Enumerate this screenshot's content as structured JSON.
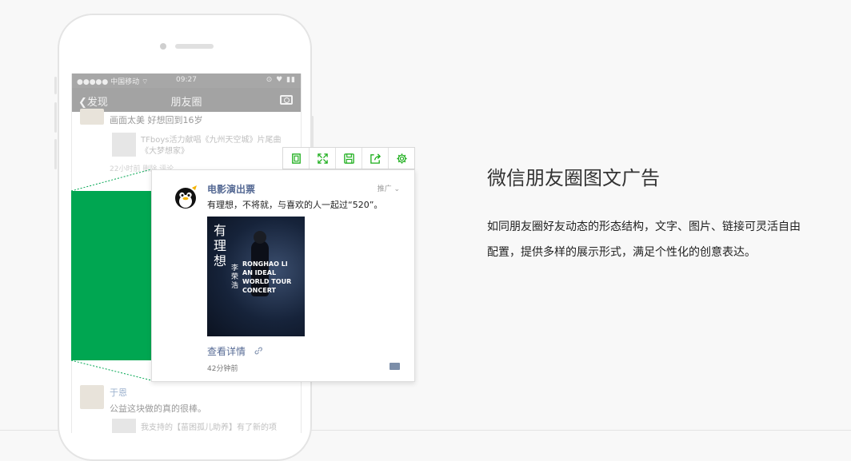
{
  "phone": {
    "statusbar": {
      "carrier": "●●●●● 中国移动 ⌔",
      "time": "09:27",
      "right_icons": "⊙ ♥ ▮▮"
    },
    "navbar": {
      "back_label": "发现",
      "title": "朋友圈",
      "camera_icon": "camera-icon"
    },
    "feed_top": {
      "post_text": "画面太美 好想回到16岁",
      "share_line1": "TFboys活力献唱《九州天空城》片尾曲",
      "share_line2": "《大梦想家》",
      "meta": "22小时前   删除  评论"
    },
    "feed_bottom": {
      "name": "于恩",
      "post_text": "公益这块做的真的很棒。",
      "share_line": "我支持的【苗困孤儿助养】有了新的项"
    }
  },
  "toolbar": {
    "tools": [
      {
        "icon": "copy-icon"
      },
      {
        "icon": "expand-icon"
      },
      {
        "icon": "save-icon"
      },
      {
        "icon": "share-icon"
      },
      {
        "icon": "gear-icon"
      }
    ],
    "color": "#1aad19"
  },
  "ad": {
    "account_name": "电影演出票",
    "tag": "推广 ⌄",
    "text": "有理想，不将就，与喜欢的人一起过“520”。",
    "poster_text": {
      "vertical": [
        "有",
        "理",
        "想"
      ],
      "singer": "李荣浩",
      "l1": "RONGHAO LI",
      "l2": "AN IDEAL",
      "l3": "WORLD TOUR",
      "l4": "CONCERT"
    },
    "link_text": "查看详情",
    "time": "42分钟前",
    "highlight_color": "#00a651",
    "link_color": "#576b95"
  },
  "info": {
    "title": "微信朋友圈图文广告",
    "description": "如同朋友圈好友动态的形态结构，文字、图片、链接可灵活自由配置，提供多样的展示形式，满足个性化的创意表达。"
  }
}
